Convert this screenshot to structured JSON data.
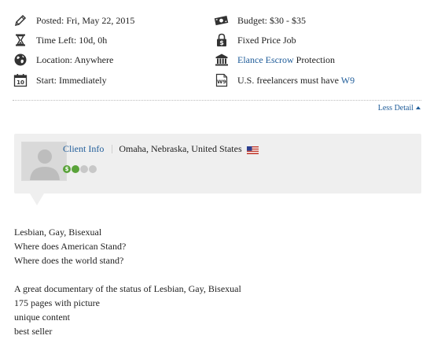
{
  "details": {
    "left": [
      {
        "icon": "pencil-icon",
        "label": "Posted: Fri, May 22, 2015"
      },
      {
        "icon": "hourglass-icon",
        "label": "Time Left: 10d, 0h"
      },
      {
        "icon": "globe-icon",
        "label": "Location: Anywhere"
      },
      {
        "icon": "calendar-icon",
        "label": "Start: Immediately",
        "icon_text": "10"
      }
    ],
    "right": {
      "budget": {
        "icon": "money-icon",
        "label": "Budget: $30 - $35"
      },
      "type": {
        "icon": "lock-dollar-icon",
        "label": "Fixed Price Job"
      },
      "escrow": {
        "icon": "bank-icon",
        "link": "Elance Escrow",
        "label": " Protection"
      },
      "w9": {
        "icon": "w9-document-icon",
        "icon_text": "W9",
        "label": "U.S. freelancers must have ",
        "link": "W9"
      }
    }
  },
  "less_detail": "Less Detail",
  "client": {
    "info_label": "Client Info",
    "location": "Omaha, Nebraska, United States",
    "flag_icon": "us-flag-icon",
    "rating_badge": "$",
    "rating_colors": [
      "#5aa33a",
      "#5aa33a",
      "#c8c8c8",
      "#c8c8c8"
    ]
  },
  "description": {
    "paragraph1": [
      "Lesbian, Gay, Bisexual",
      "Where does American Stand?",
      "Where does the world stand?"
    ],
    "paragraph2": [
      "A great documentary of the status of Lesbian, Gay, Bisexual",
      "175 pages with picture",
      "unique content",
      "best seller"
    ]
  }
}
